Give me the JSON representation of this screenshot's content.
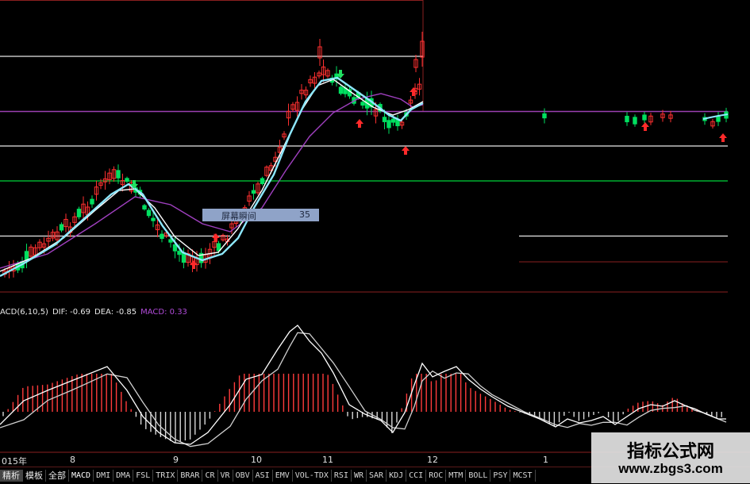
{
  "macd_label": {
    "name": "ACD(6,10,5)",
    "dif": "DIF: -0.69",
    "dea": "DEA: -0.85",
    "macd": "MACD: 0.33",
    "color_white": "#e8e8e8",
    "color_macd": "#b04bd8"
  },
  "tooltip": {
    "label": "屏幕瞬间",
    "value": "35"
  },
  "x_axis_labels": [
    "015年",
    "8",
    "9",
    "10",
    "11",
    "12",
    "1"
  ],
  "tabs": [
    "精析",
    "模板",
    "全部",
    "MACD",
    "DMI",
    "DMA",
    "FSL",
    "TRIX",
    "BRAR",
    "CR",
    "VR",
    "OBV",
    "ASI",
    "EMV",
    "VOL-TDX",
    "RSI",
    "WR",
    "SAR",
    "KDJ",
    "CCI",
    "ROC",
    "MTM",
    "BOLL",
    "PSY",
    "MCST"
  ],
  "watermark": {
    "title": "指标公式网",
    "url": "www.zbgs3.com"
  },
  "colors": {
    "background": "#000000",
    "up_candle": "#ff3030",
    "down_candle": "#00e060",
    "ma_fast": "#8de8ff",
    "ma_mid": "#ffffff",
    "ma_slow": "#a040c0",
    "green_line": "#00b030",
    "purple_line": "#9a3fb0",
    "panel_border": "#8a1f1f"
  },
  "chart_data": {
    "type": "candlestick_with_macd",
    "x": [
      "015年",
      "8",
      "9",
      "10",
      "11",
      "12",
      "1"
    ],
    "macd_params": [
      6,
      10,
      5
    ],
    "dif": -0.69,
    "dea": -0.85,
    "macd": 0.33
  }
}
